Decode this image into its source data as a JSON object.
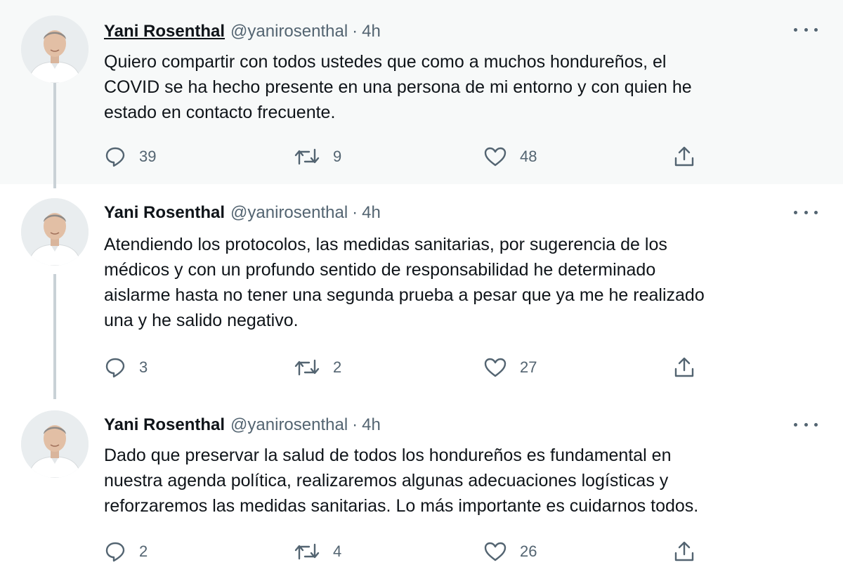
{
  "colors": {
    "highlight_bg": "#f7f9f9",
    "text": "#0f1419",
    "secondary": "#536471",
    "thread_line": "#c9d1d6"
  },
  "tweets": [
    {
      "author_name": "Yani Rosenthal",
      "handle": "@yanirosenthal",
      "separator": "·",
      "time": "4h",
      "lines": [
        "Quiero compartir con todos ustedes que como a muchos hondureños, el",
        "COVID se ha hecho presente en una persona de mi entorno y con quien he",
        "estado en contacto frecuente."
      ],
      "replies": "39",
      "retweets": "9",
      "likes": "48"
    },
    {
      "author_name": "Yani Rosenthal",
      "handle": "@yanirosenthal",
      "separator": "·",
      "time": "4h",
      "lines": [
        "Atendiendo los protocolos, las medidas sanitarias, por sugerencia de los",
        "médicos y con un profundo sentido de responsabilidad he determinado",
        "aislarme hasta no tener una segunda prueba a pesar que ya me he realizado",
        "una y he salido negativo."
      ],
      "replies": "3",
      "retweets": "2",
      "likes": "27"
    },
    {
      "author_name": "Yani Rosenthal",
      "handle": "@yanirosenthal",
      "separator": "·",
      "time": "4h",
      "lines": [
        "Dado que preservar la salud de todos los hondureños es fundamental en",
        "nuestra agenda política, realizaremos algunas adecuaciones logísticas y",
        "reforzaremos las medidas sanitarias. Lo más importante es cuidarnos todos."
      ],
      "replies": "2",
      "retweets": "4",
      "likes": "26"
    }
  ]
}
